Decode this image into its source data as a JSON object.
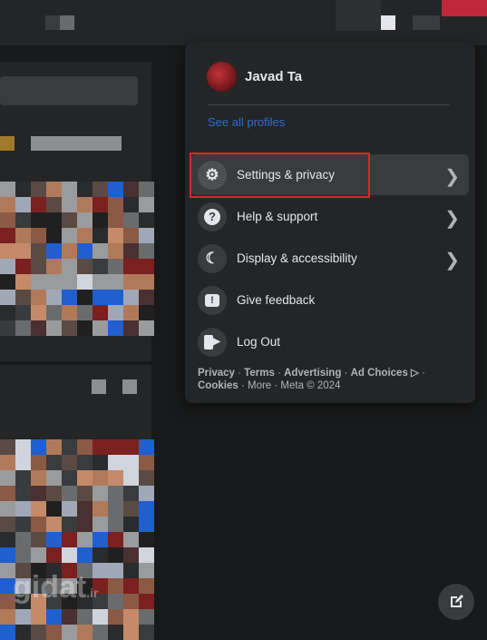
{
  "menu": {
    "profile_name": "Javad Ta",
    "see_all_profiles": "See all profiles",
    "items": [
      {
        "label": "Settings & privacy",
        "icon": "gear-icon",
        "chevron": true,
        "highlighted": true
      },
      {
        "label": "Help & support",
        "icon": "question-icon",
        "chevron": true
      },
      {
        "label": "Display & accessibility",
        "icon": "moon-icon",
        "chevron": true
      },
      {
        "label": "Give feedback",
        "icon": "feedback-icon",
        "chevron": false
      },
      {
        "label": "Log Out",
        "icon": "logout-icon",
        "chevron": false
      }
    ],
    "footer": {
      "privacy": "Privacy",
      "terms": "Terms",
      "advertising": "Advertising",
      "ad_choices": "Ad Choices ▷",
      "cookies": "Cookies",
      "more": "More",
      "copyright": "Meta © 2024"
    }
  },
  "watermark": "gidat.ir",
  "colors": {
    "highlight_border": "#d9262c",
    "link": "#2d6cd6",
    "panel": "#242526"
  }
}
